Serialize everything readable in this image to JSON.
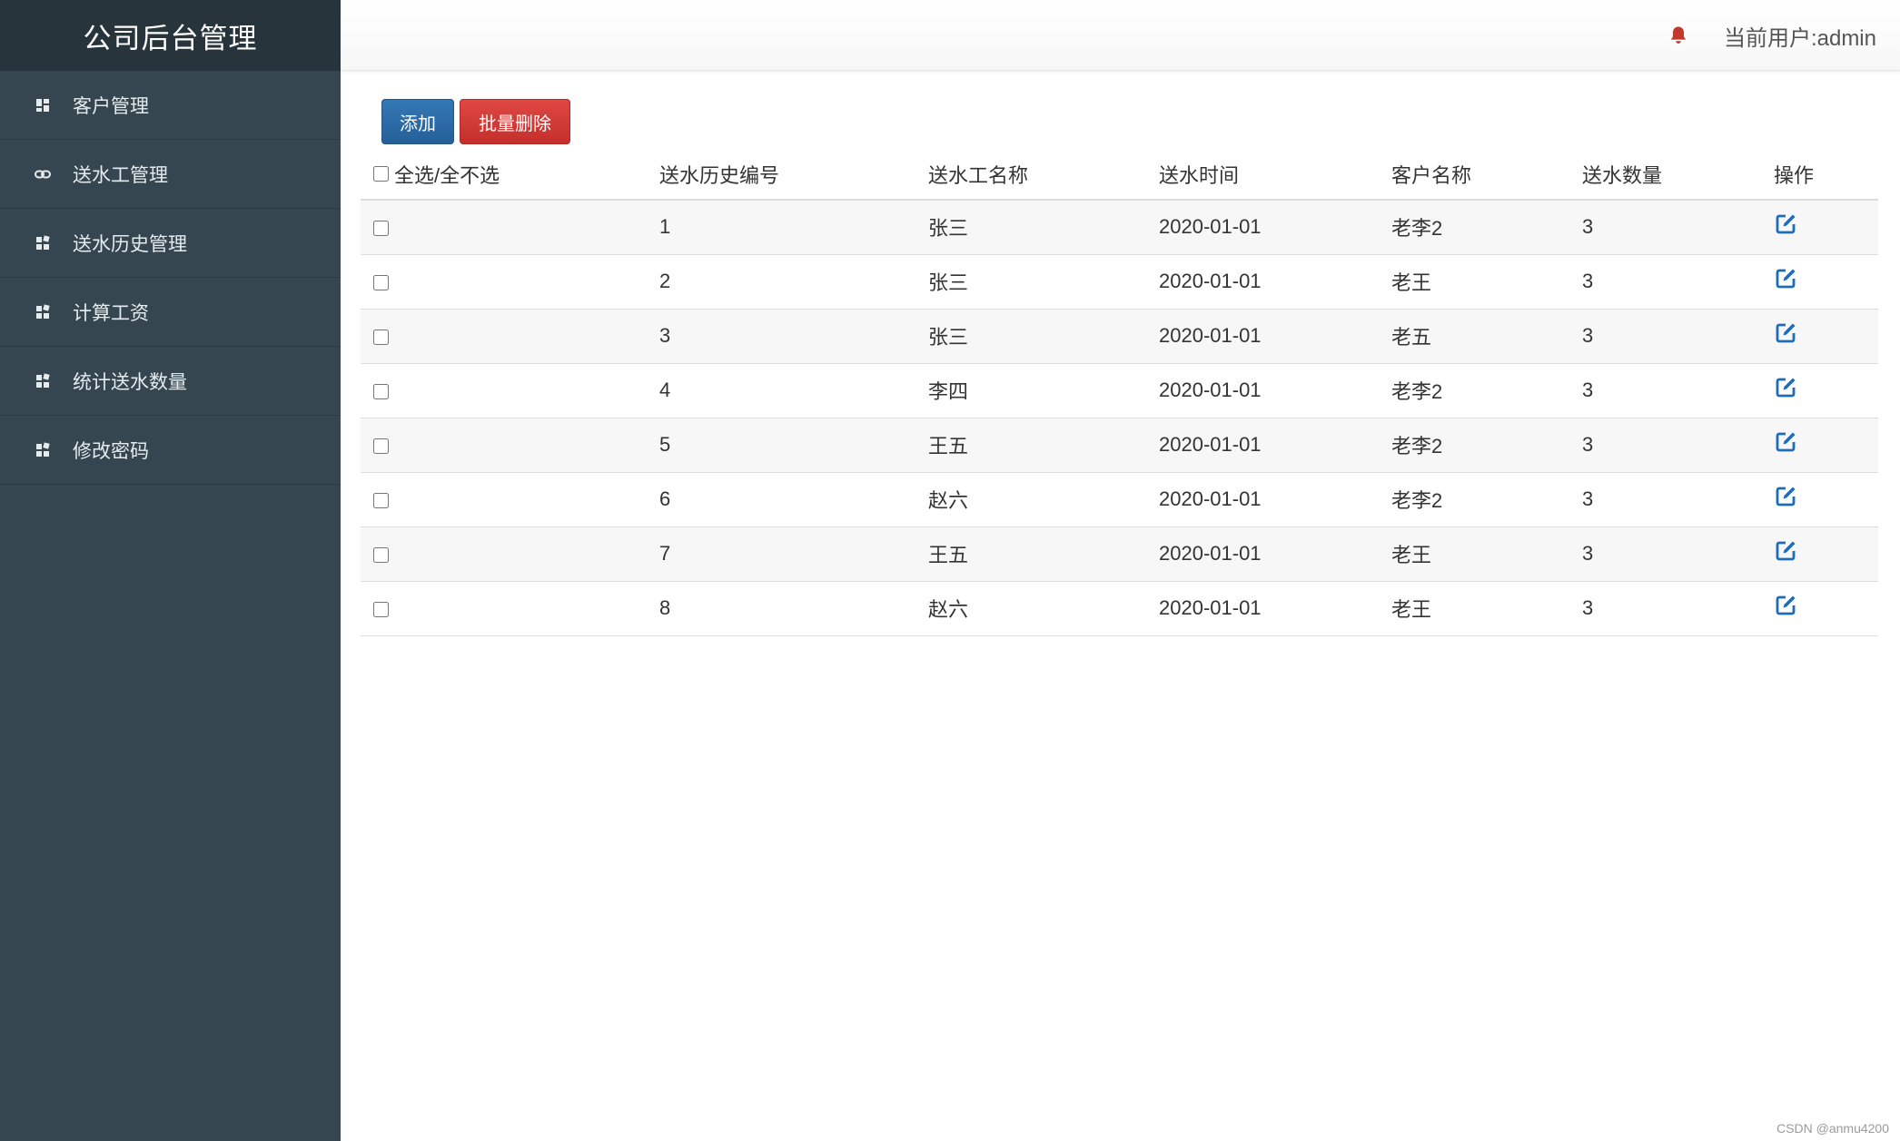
{
  "app": {
    "title": "公司后台管理"
  },
  "sidebar": {
    "items": [
      {
        "label": "客户管理",
        "icon": "dashboard-icon"
      },
      {
        "label": "送水工管理",
        "icon": "link-icon"
      },
      {
        "label": "送水历史管理",
        "icon": "puzzle-icon"
      },
      {
        "label": "计算工资",
        "icon": "puzzle-icon"
      },
      {
        "label": "统计送水数量",
        "icon": "puzzle-icon"
      },
      {
        "label": "修改密码",
        "icon": "puzzle-icon"
      }
    ]
  },
  "header": {
    "current_user": "当前用户:admin",
    "bell_icon": "bell-icon"
  },
  "toolbar": {
    "add_label": "添加",
    "batch_delete_label": "批量删除"
  },
  "table": {
    "select_all_label": "全选/全不选",
    "columns": [
      "送水历史编号",
      "送水工名称",
      "送水时间",
      "客户名称",
      "送水数量",
      "操作"
    ],
    "rows": [
      {
        "id": "1",
        "worker": "张三",
        "time": "2020-01-01",
        "customer": "老李2",
        "qty": "3"
      },
      {
        "id": "2",
        "worker": "张三",
        "time": "2020-01-01",
        "customer": "老王",
        "qty": "3"
      },
      {
        "id": "3",
        "worker": "张三",
        "time": "2020-01-01",
        "customer": "老五",
        "qty": "3"
      },
      {
        "id": "4",
        "worker": "李四",
        "time": "2020-01-01",
        "customer": "老李2",
        "qty": "3"
      },
      {
        "id": "5",
        "worker": "王五",
        "time": "2020-01-01",
        "customer": "老李2",
        "qty": "3"
      },
      {
        "id": "6",
        "worker": "赵六",
        "time": "2020-01-01",
        "customer": "老李2",
        "qty": "3"
      },
      {
        "id": "7",
        "worker": "王五",
        "time": "2020-01-01",
        "customer": "老王",
        "qty": "3"
      },
      {
        "id": "8",
        "worker": "赵六",
        "time": "2020-01-01",
        "customer": "老王",
        "qty": "3"
      }
    ]
  },
  "watermark": "CSDN @anmu4200",
  "colors": {
    "sidebar_bg": "#354650",
    "brand_bg": "#27343c",
    "primary": "#2d6da8",
    "danger": "#d9403b",
    "bell": "#c0392b",
    "edit_icon": "#1e6bb8"
  }
}
